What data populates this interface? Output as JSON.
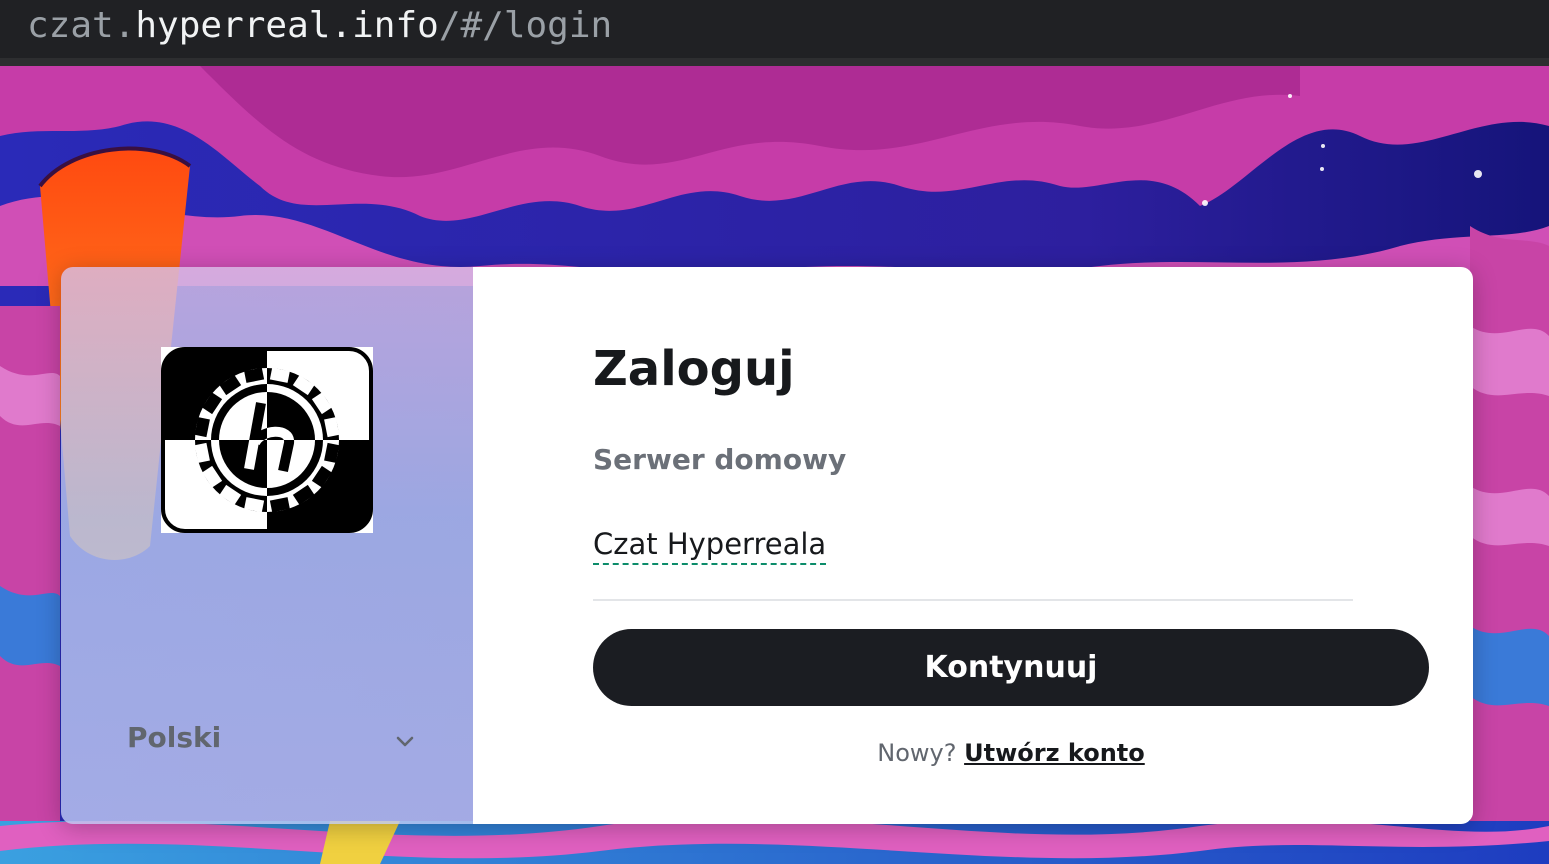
{
  "browser": {
    "url_scheme_part": "czat.",
    "url_host": "hyperreal.info",
    "url_path": "/#/login"
  },
  "sidebar": {
    "logo_icon": "hyperreal-gear-logo",
    "language_label": "Polski"
  },
  "login": {
    "title": "Zaloguj",
    "homeserver_label": "Serwer domowy",
    "homeserver_value": "Czat Hyperreala",
    "continue_label": "Kontynuuj",
    "new_prefix": "Nowy?",
    "create_account_label": "Utwórz konto"
  },
  "colors": {
    "button_bg": "#1b1d22",
    "dashed_underline": "#0c8c6a",
    "background_magenta": "#c43fa6",
    "background_blue": "#1b1fa0"
  }
}
